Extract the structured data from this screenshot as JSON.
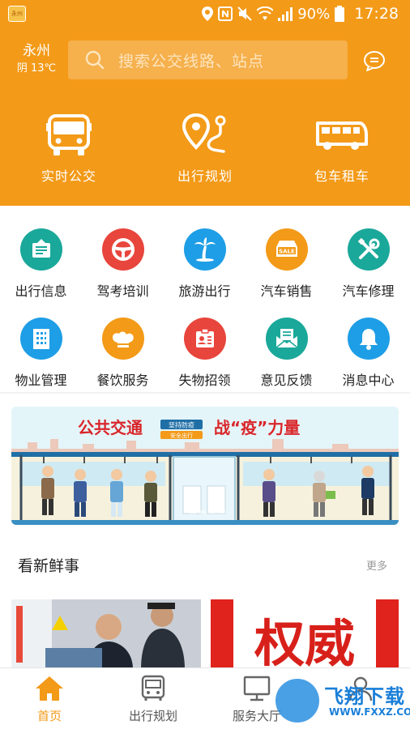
{
  "status_bar": {
    "battery": "90%",
    "time": "17:28",
    "app_badge": "永州公交"
  },
  "header": {
    "city": "永州",
    "weather": "阴 13℃",
    "search_placeholder": "搜索公交线路、站点"
  },
  "main_nav": [
    {
      "label": "实时公交",
      "icon": "bus-icon"
    },
    {
      "label": "出行规划",
      "icon": "route-pin-icon"
    },
    {
      "label": "包车租车",
      "icon": "coach-icon"
    }
  ],
  "services": [
    {
      "label": "出行信息",
      "icon": "info-board-icon",
      "color": "#1aa89a"
    },
    {
      "label": "驾考培训",
      "icon": "steering-wheel-icon",
      "color": "#e8453c"
    },
    {
      "label": "旅游出行",
      "icon": "palm-tree-icon",
      "color": "#1e9ee6"
    },
    {
      "label": "汽车销售",
      "icon": "sale-tag-icon",
      "color": "#f39a18"
    },
    {
      "label": "汽车修理",
      "icon": "repair-tools-icon",
      "color": "#1aa89a"
    },
    {
      "label": "物业管理",
      "icon": "building-icon",
      "color": "#1e9ee6"
    },
    {
      "label": "餐饮服务",
      "icon": "chef-hat-icon",
      "color": "#f39a18"
    },
    {
      "label": "失物招领",
      "icon": "id-card-icon",
      "color": "#e8453c"
    },
    {
      "label": "意见反馈",
      "icon": "mail-icon",
      "color": "#1aa89a"
    },
    {
      "label": "消息中心",
      "icon": "bell-icon",
      "color": "#1e9ee6"
    }
  ],
  "banner": {
    "title_left": "公共交通",
    "title_right": "战“疫”力量",
    "tag1": "坚持防疫",
    "tag2": "安全出行"
  },
  "news": {
    "title": "看新鲜事",
    "more": "更多",
    "img2_text": "权威"
  },
  "tabbar": [
    {
      "label": "首页",
      "icon": "home-icon",
      "active": true
    },
    {
      "label": "出行规划",
      "icon": "bus-front-icon",
      "active": false
    },
    {
      "label": "服务大厅",
      "icon": "monitor-icon",
      "active": false
    },
    {
      "label": "",
      "icon": "user-icon",
      "active": false
    }
  ],
  "watermark": {
    "text": "飞翔下载",
    "url": "WWW.FXXZ.COM"
  },
  "colors": {
    "primary": "#f39a18",
    "search_bg": "#f6b04c"
  }
}
